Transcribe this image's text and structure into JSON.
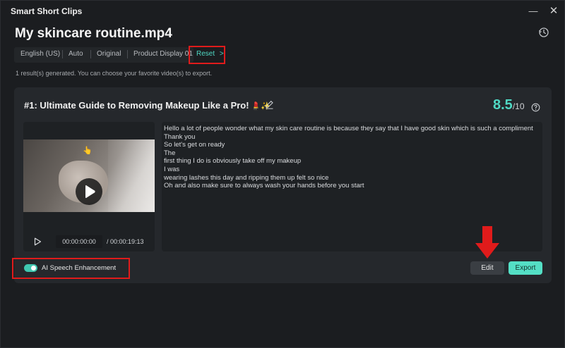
{
  "window": {
    "app_title": "Smart Short Clips",
    "minimize_glyph": "—",
    "close_glyph": "✕"
  },
  "header": {
    "file_title": "My skincare routine.mp4",
    "history_icon": "history-icon"
  },
  "tags": [
    "English (US)",
    "Auto",
    "Original",
    "Product Display 01"
  ],
  "reset": {
    "label": "Reset",
    "chevron": ">"
  },
  "info_line": "1 result(s) generated. You can choose your favorite video(s) to export.",
  "clip": {
    "title": "#1:  Ultimate Guide to Removing Makeup Like a Pro!",
    "title_emojis": "💄✨",
    "score": "8.5",
    "score_denominator": "/10",
    "thumbnail_emoji": "👆",
    "current_time": "00:00:00:00",
    "duration": "/   00:00:19:13",
    "transcript": [
      "Hello a lot of people wonder what my skin care routine is because they say that I have good skin which is such a compliment",
      "Thank you",
      "So let's get on ready",
      "The",
      "first thing I do is obviously take off my makeup",
      "I was",
      "wearing lashes this day and ripping them up felt so nice",
      "Oh and also make sure to always wash your hands before you start"
    ]
  },
  "ai_speech": {
    "label": "AI Speech Enhancement",
    "enabled": true
  },
  "actions": {
    "edit_label": "Edit",
    "export_label": "Export"
  },
  "colors": {
    "accent": "#4fd8c3",
    "export_bg": "#54dfc5",
    "highlight_red": "#e01b1b",
    "background": "#1b1d20",
    "card": "#25282c"
  }
}
